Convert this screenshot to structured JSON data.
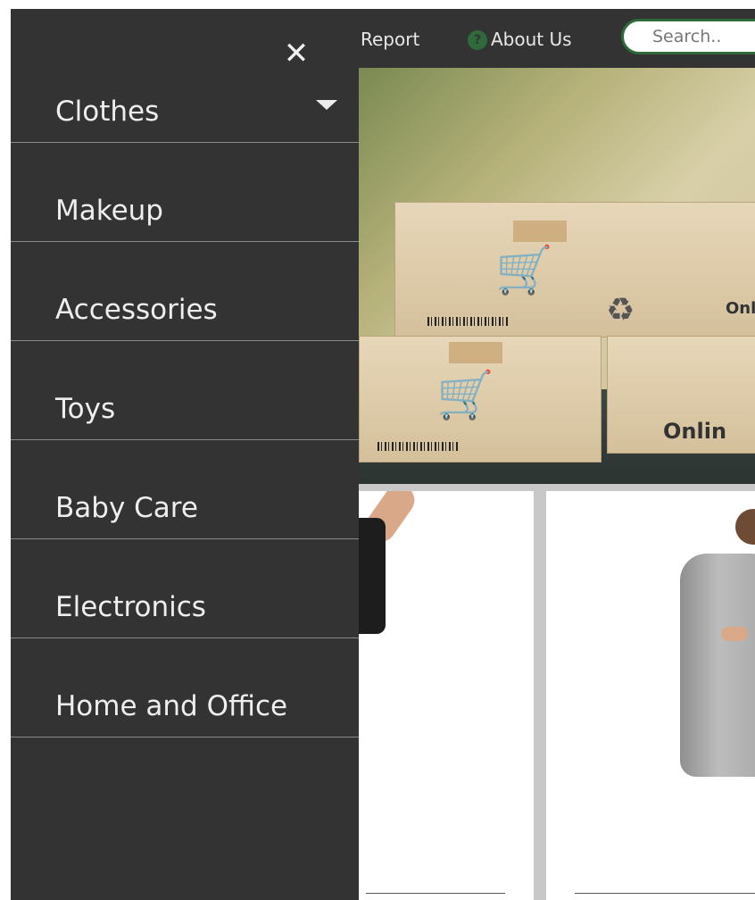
{
  "header": {
    "report_label": "Report",
    "about_label": "About Us",
    "help_icon": "?",
    "search_placeholder": "Search.."
  },
  "sidebar": {
    "close_glyph": "✕",
    "items": [
      {
        "label": "Clothes",
        "has_dropdown": true
      },
      {
        "label": "Makeup"
      },
      {
        "label": "Accessories"
      },
      {
        "label": "Toys"
      },
      {
        "label": "Baby Care"
      },
      {
        "label": "Electronics"
      },
      {
        "label": "Home and Office"
      }
    ]
  },
  "hero": {
    "box_text_1": "Onli",
    "box_text_2": "Onlin"
  },
  "colors": {
    "sidebar_bg": "#333333",
    "accent_green": "#2f6b3a",
    "text_light": "#eeeeee"
  }
}
